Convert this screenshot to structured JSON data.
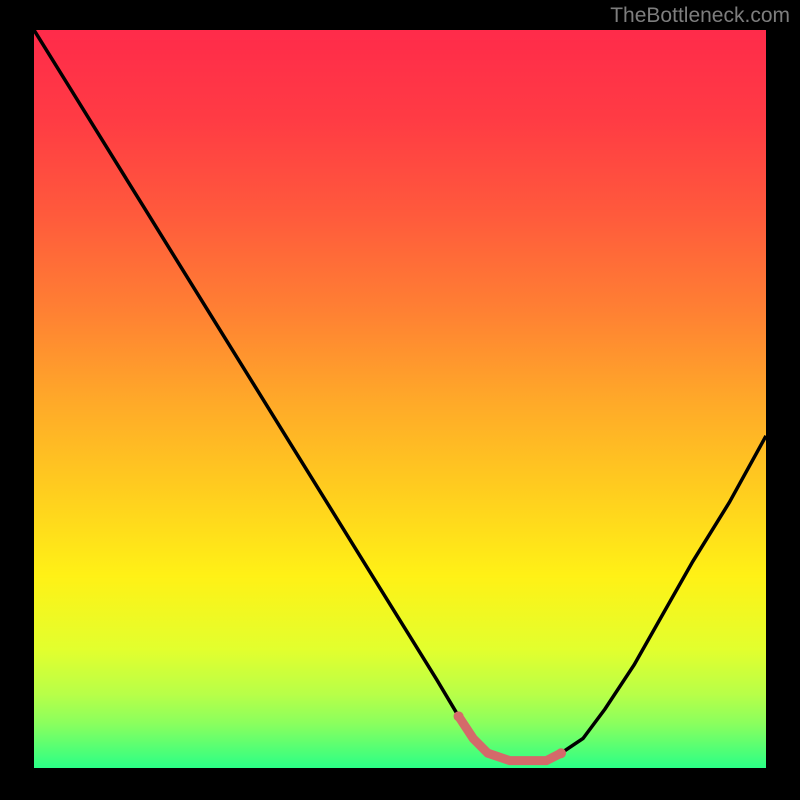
{
  "watermark": "TheBottleneck.com",
  "chart_data": {
    "type": "line",
    "title": "",
    "xlabel": "",
    "ylabel": "",
    "ylim": [
      0,
      100
    ],
    "xlim": [
      0,
      100
    ],
    "curve": {
      "x": [
        0,
        5,
        10,
        15,
        20,
        25,
        30,
        35,
        40,
        45,
        50,
        55,
        58,
        60,
        62,
        65,
        68,
        70,
        72,
        75,
        78,
        82,
        86,
        90,
        95,
        100
      ],
      "y": [
        100,
        92,
        84,
        76,
        68,
        60,
        52,
        44,
        36,
        28,
        20,
        12,
        7,
        4,
        2,
        1,
        1,
        1,
        2,
        4,
        8,
        14,
        21,
        28,
        36,
        45
      ]
    },
    "highlight_segment": {
      "x": [
        58,
        60,
        62,
        65,
        68,
        70,
        72
      ],
      "y": [
        7,
        4,
        2,
        1,
        1,
        1,
        2
      ]
    },
    "gradient_stops": [
      {
        "offset": 0.0,
        "color": "#ff2b4a"
      },
      {
        "offset": 0.12,
        "color": "#ff3b44"
      },
      {
        "offset": 0.25,
        "color": "#ff5a3c"
      },
      {
        "offset": 0.38,
        "color": "#ff8033"
      },
      {
        "offset": 0.5,
        "color": "#ffa829"
      },
      {
        "offset": 0.62,
        "color": "#ffcc1f"
      },
      {
        "offset": 0.74,
        "color": "#fff116"
      },
      {
        "offset": 0.84,
        "color": "#e2ff2e"
      },
      {
        "offset": 0.9,
        "color": "#b8ff48"
      },
      {
        "offset": 0.94,
        "color": "#8aff5e"
      },
      {
        "offset": 0.97,
        "color": "#5aff72"
      },
      {
        "offset": 1.0,
        "color": "#2bff86"
      }
    ],
    "curve_color": "#000000",
    "highlight_color": "#d46a6a"
  }
}
